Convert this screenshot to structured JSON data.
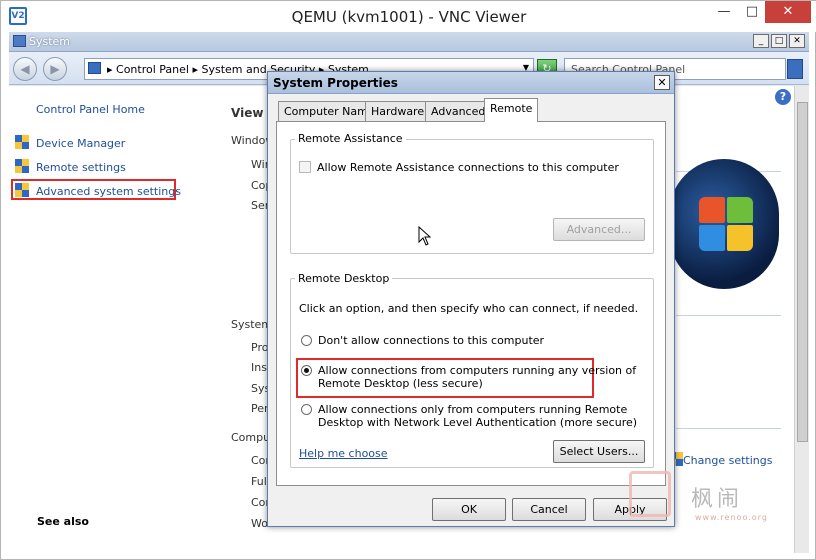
{
  "vnc": {
    "title": "QEMU (kvm1001) - VNC Viewer",
    "logo": "V2",
    "controls": {
      "minimize": "—",
      "maximize": "□",
      "close": "✕"
    }
  },
  "system_window": {
    "title": "System",
    "breadcrumb": "▸ Control Panel ▸ System and Security ▸ System",
    "search_placeholder": "Search Control Panel",
    "controls": {
      "minimize": "_",
      "maximize": "□",
      "close": "✕"
    }
  },
  "left_nav": {
    "home": "Control Panel Home",
    "items": [
      "Device Manager",
      "Remote settings",
      "Advanced system settings"
    ],
    "see_also": "See also"
  },
  "main": {
    "view_basic": "View b",
    "windows_edition": "Window",
    "edition_rows": [
      "Win",
      "Cop",
      "Ser"
    ],
    "system_section": "System",
    "system_rows": [
      "Pro",
      "Ins",
      "Sys",
      "Pen"
    ],
    "computer_section": "Comput",
    "computer_rows": [
      "Cor",
      "Full",
      "Cor",
      "Wo"
    ],
    "change_settings": "Change settings"
  },
  "dialog": {
    "title": "System Properties",
    "close": "✕",
    "tabs": [
      "Computer Name",
      "Hardware",
      "Advanced",
      "Remote"
    ],
    "active_tab": "Remote",
    "remote_assistance": {
      "label": "Remote Assistance",
      "allow_checkbox": "Allow Remote Assistance connections to this computer",
      "advanced_button": "Advanced..."
    },
    "remote_desktop": {
      "label": "Remote Desktop",
      "instructions": "Click an option, and then specify who can connect, if needed.",
      "options": [
        "Don't allow connections to this computer",
        "Allow connections from computers running any version of",
        "Allow connections only from computers running Remote"
      ],
      "options_line2": [
        "",
        "Remote Desktop (less secure)",
        "Desktop with Network Level Authentication (more secure)"
      ],
      "selected_index": 1,
      "help_link": "Help me choose",
      "select_users_button": "Select Users..."
    },
    "buttons": {
      "ok": "OK",
      "cancel": "Cancel",
      "apply": "Apply"
    }
  },
  "watermark": {
    "text": "枫闹",
    "url": "www.renoo.org"
  },
  "colors": {
    "highlight": "#e02a2a",
    "link": "#1f4e9a",
    "accent": "#5b7eb0"
  }
}
